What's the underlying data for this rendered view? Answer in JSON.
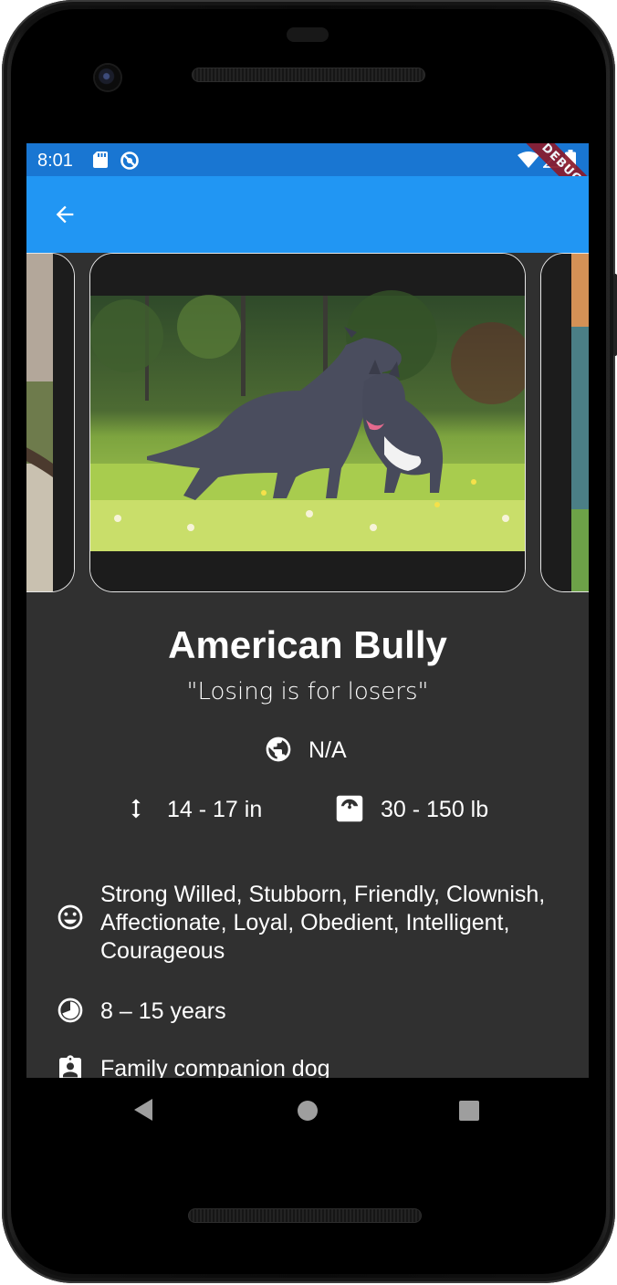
{
  "status_bar": {
    "time": "8:01",
    "debug_label": "DEBUG"
  },
  "app_bar": {
    "back_icon": "arrow-back-icon"
  },
  "breed": {
    "name": "American Bully",
    "motto": "\"Losing is for losers\"",
    "origin": "N/A",
    "height": "14 - 17 in",
    "weight": "30 - 150 lb",
    "temperament": "Strong Willed, Stubborn, Friendly, Clownish, Affectionate, Loyal, Obedient, Intelligent, Courageous",
    "life_span": "8 – 15 years",
    "bred_for": "Family companion dog"
  },
  "colors": {
    "status_bar": "#1976d2",
    "app_bar": "#2196f3",
    "background": "#303030"
  }
}
